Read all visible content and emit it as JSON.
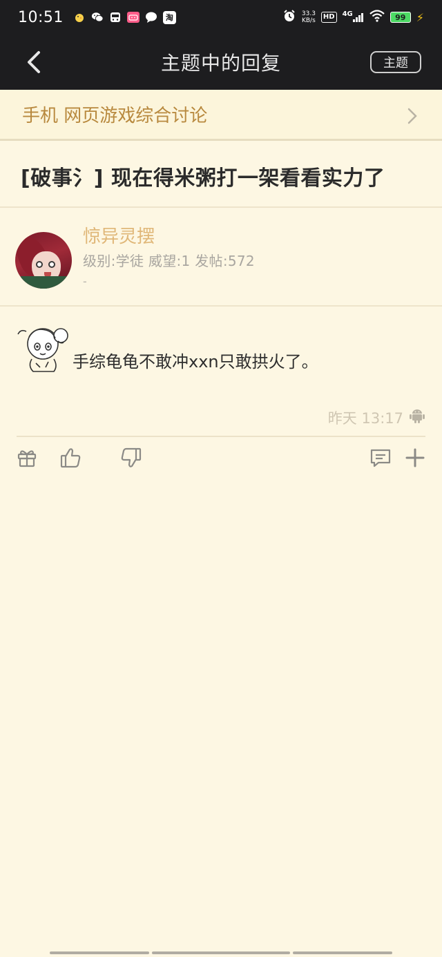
{
  "status_bar": {
    "time": "10:51",
    "netspeed_value": "33.3",
    "netspeed_unit": "KB/s",
    "hd": "HD",
    "network": "4G",
    "battery": "99",
    "app_icons": [
      "chick-icon",
      "wechat-icon",
      "bus-icon",
      "bilibili-icon",
      "message-icon",
      "taobao-icon"
    ],
    "taobao_label": "淘"
  },
  "header": {
    "title": "主题中的回复",
    "topic_button_label": "主题"
  },
  "forum": {
    "name": "手机 网页游戏综合讨论"
  },
  "thread": {
    "title": "[破事氵] 现在得米粥打一架看看实力了"
  },
  "user": {
    "name": "惊异灵摆",
    "stats": "级别:学徒 威望:1 发帖:572",
    "signature": "-"
  },
  "post": {
    "text": "手综龟龟不敢冲xxn只敢拱火了。",
    "time": "昨天 13:17",
    "client_icon": "android-icon"
  },
  "actions": [
    "gift-icon",
    "thumbs-up-icon",
    "thumbs-down-icon",
    "comment-icon",
    "plus-icon"
  ],
  "colors": {
    "background": "#fdf7e3",
    "header_bg": "#1d1d1f",
    "forum_text": "#b8893e",
    "username": "#e0b778",
    "meta_text": "#a9a6a0"
  }
}
